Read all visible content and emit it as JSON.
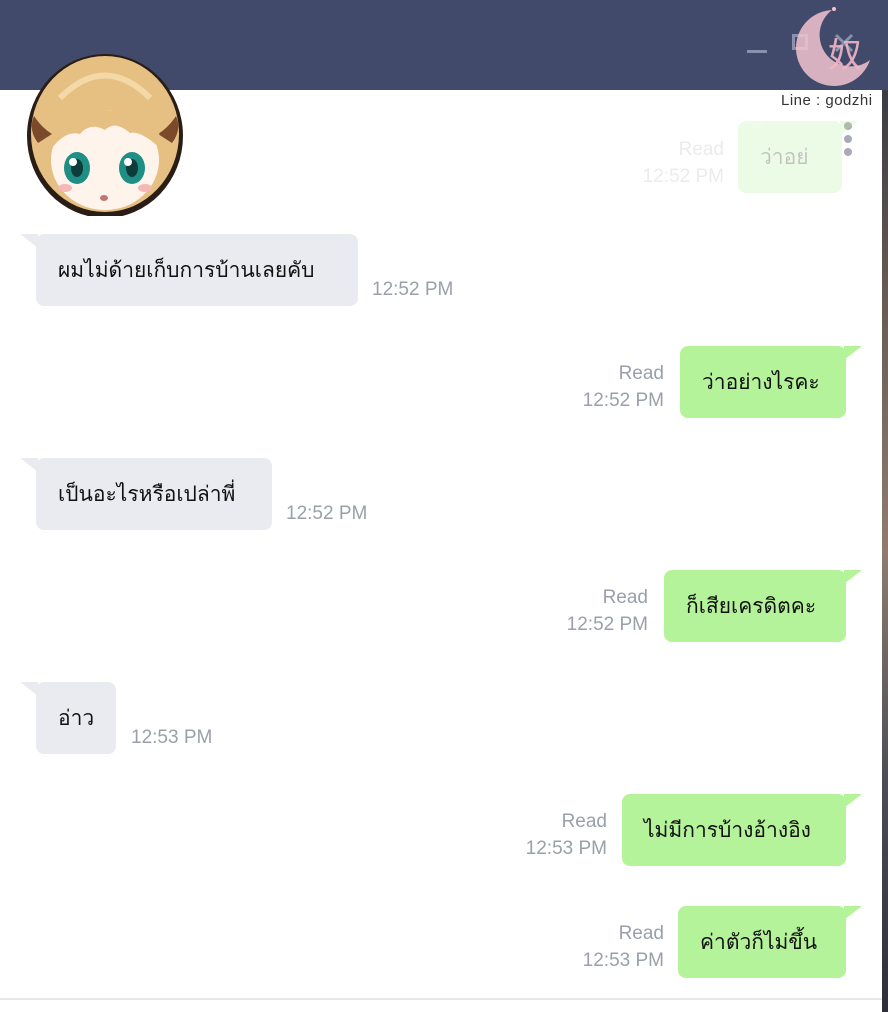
{
  "window": {
    "controls": [
      "minimize",
      "maximize",
      "close"
    ],
    "accent_color": "#414a6b"
  },
  "watermark": {
    "text": "Line : godzhi"
  },
  "chat": {
    "partial_top_message": {
      "text": "ว่าอย่",
      "read": "Read",
      "time": "12:52 PM"
    },
    "messages": [
      {
        "direction": "incoming",
        "text": "ผมไม่ด้ายเก็บการบ้านเลยคับ",
        "time": "12:52 PM"
      },
      {
        "direction": "outgoing",
        "text": "ว่าอย่างไรคะ",
        "read": "Read",
        "time": "12:52 PM"
      },
      {
        "direction": "incoming",
        "text": "เป็นอะไรหรือเปล่าพี่",
        "time": "12:52 PM"
      },
      {
        "direction": "outgoing",
        "text": "ก็เสียเครดิตคะ",
        "read": "Read",
        "time": "12:52 PM"
      },
      {
        "direction": "incoming",
        "text": "อ่าว",
        "time": "12:53 PM"
      },
      {
        "direction": "outgoing",
        "text": "ไม่มีการบ้างอ้างอิง",
        "read": "Read",
        "time": "12:53 PM"
      },
      {
        "direction": "outgoing",
        "text": "ค่าตัวก็ไม่ขึ้น",
        "read": "Read",
        "time": "12:53 PM"
      }
    ],
    "colors": {
      "incoming_bubble": "#eaebf0",
      "outgoing_bubble": "#b5f39a",
      "meta_text": "#9aa0aa"
    }
  },
  "icons": {
    "menu": "more-vertical-icon",
    "avatar": "anime-girl-avatar",
    "watermark": "moon-logo-icon"
  }
}
